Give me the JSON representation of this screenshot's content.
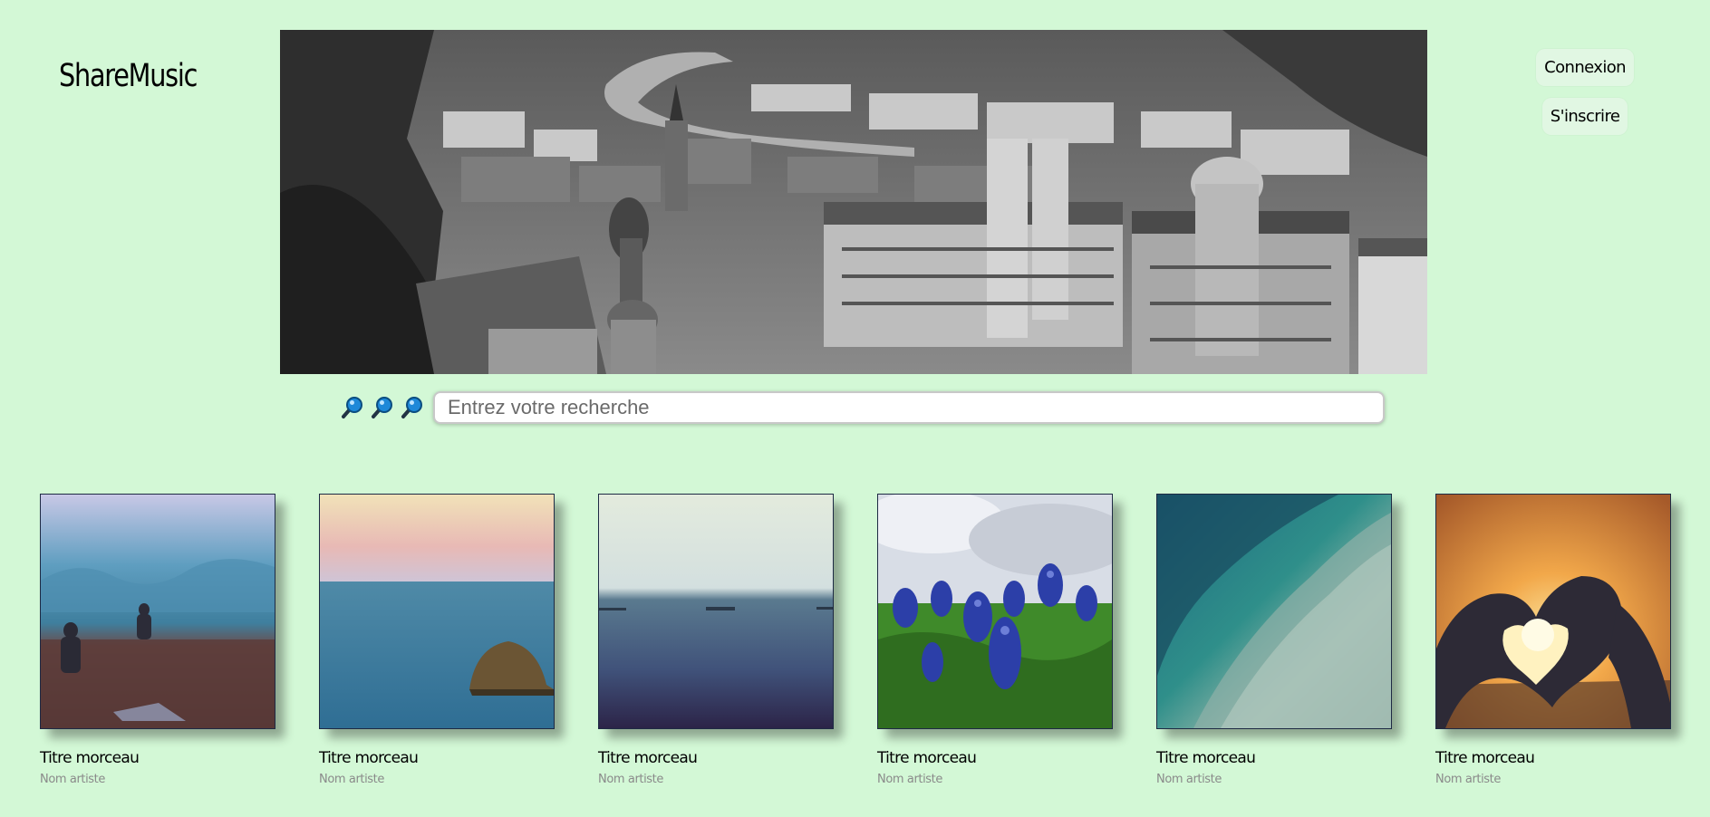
{
  "app": {
    "logo": "ShareMusic"
  },
  "header": {
    "login_label": "Connexion",
    "signup_label": "S'inscrire"
  },
  "banner": {
    "icon": "city-photo"
  },
  "search": {
    "placeholder": "Entrez votre recherche",
    "value": "",
    "icons": [
      "magnifier-icon",
      "magnifier-icon",
      "magnifier-icon"
    ]
  },
  "tracks": [
    {
      "title": "Titre morceau",
      "artist": "Nom artiste",
      "cover": "misty-field-photo"
    },
    {
      "title": "Titre morceau",
      "artist": "Nom artiste",
      "cover": "sea-rock-photo"
    },
    {
      "title": "Titre morceau",
      "artist": "Nom artiste",
      "cover": "calm-sea-ships-photo"
    },
    {
      "title": "Titre morceau",
      "artist": "Nom artiste",
      "cover": "bluebonnet-flowers-photo"
    },
    {
      "title": "Titre morceau",
      "artist": "Nom artiste",
      "cover": "ocean-wave-photo"
    },
    {
      "title": "Titre morceau",
      "artist": "Nom artiste",
      "cover": "heart-hands-sunset-photo"
    }
  ],
  "colors": {
    "background": "#d3f8d6",
    "button_bg": "#e1f7e3",
    "artist_text": "#8a8a8a"
  }
}
